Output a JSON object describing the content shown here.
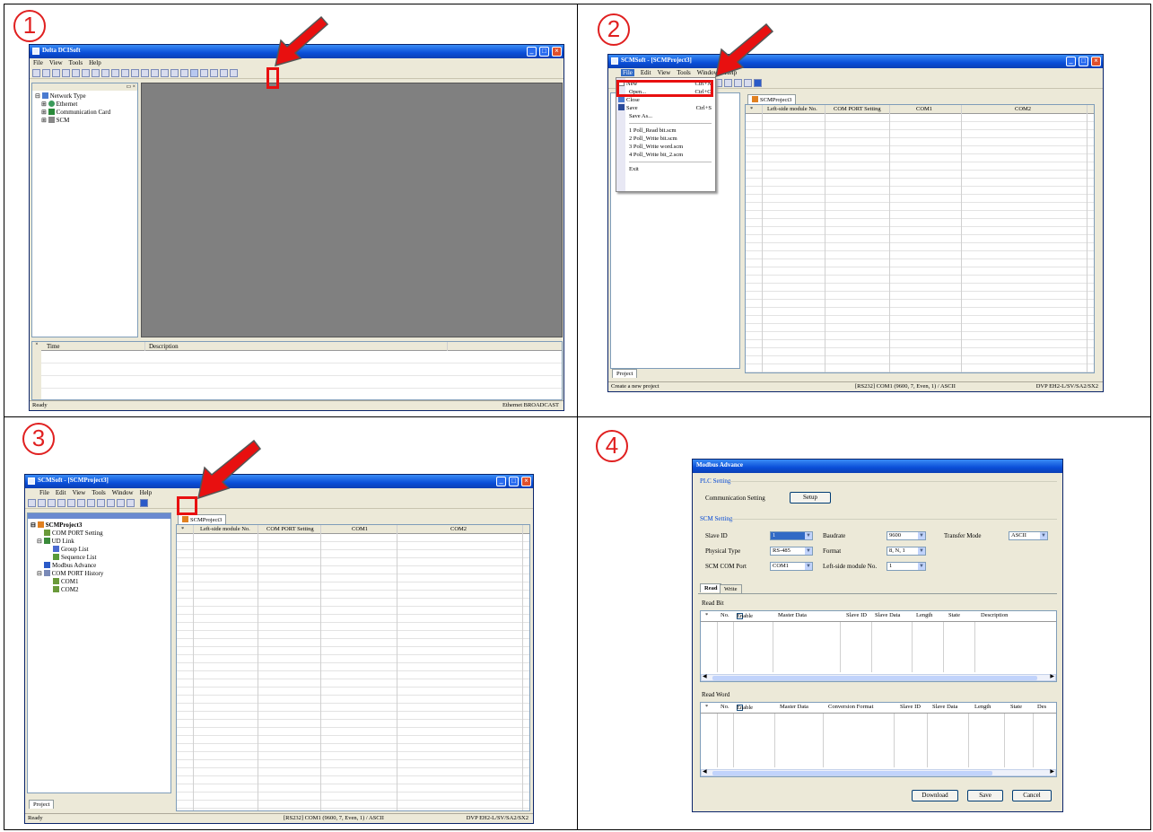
{
  "steps": [
    "1",
    "2",
    "3",
    "4"
  ],
  "p1": {
    "title": "Delta DCISoft",
    "menu": [
      "File",
      "View",
      "Tools",
      "Help"
    ],
    "tree": [
      "Network Type",
      "Ethernet",
      "Communication Card",
      "SCM"
    ],
    "log_cols": [
      "Time",
      "Description"
    ],
    "status_left": "Ready",
    "status_right": "Ethernet  BROADCAST"
  },
  "p2": {
    "title": "SCMSoft - [SCMProject3]",
    "menu": [
      "File",
      "Edit",
      "View",
      "Tools",
      "Window",
      "Help"
    ],
    "file_menu": [
      {
        "label": "New",
        "key": "Ctrl+N"
      },
      {
        "label": "Open...",
        "key": "Ctrl+O"
      },
      {
        "label": "Close",
        "key": ""
      },
      {
        "label": "Save",
        "key": "Ctrl+S"
      },
      {
        "label": "Save As...",
        "key": ""
      },
      {
        "label": "1 Poll_Read bit.scm",
        "key": ""
      },
      {
        "label": "2 Poll_Write bit.scm",
        "key": ""
      },
      {
        "label": "3 Poll_Write word.scm",
        "key": ""
      },
      {
        "label": "4 Poll_Write bit_2.scm",
        "key": ""
      },
      {
        "label": "Exit",
        "key": ""
      }
    ],
    "doc_tab": "SCMProject3",
    "cols": [
      "*",
      "Left-side module No.",
      "COM PORT Setting",
      "COM1",
      "COM2"
    ],
    "project_tab": "Project",
    "status_left": "Create a new project",
    "status_mid": "[RS232] COM1 (9600, 7, Even, 1) / ASCII",
    "status_right": "DVP EH2-L/SV/SA2/SX2"
  },
  "p3": {
    "title": "SCMSoft - [SCMProject3]",
    "menu": [
      "File",
      "Edit",
      "View",
      "Tools",
      "Window",
      "Help"
    ],
    "tree": [
      "SCMProject3",
      "COM PORT Setting",
      "UD Link",
      "Group List",
      "Sequence List",
      "Modbus Advance",
      "COM PORT History",
      "COM1",
      "COM2"
    ],
    "doc_tab": "SCMProject3",
    "cols": [
      "*",
      "Left-side module No.",
      "COM PORT Setting",
      "COM1",
      "COM2"
    ],
    "project_tab": "Project",
    "status_left": "Ready",
    "status_mid": "[RS232] COM1 (9600, 7, Even, 1) / ASCII",
    "status_right": "DVP EH2-L/SV/SA2/SX2"
  },
  "p4": {
    "title": "Modbus Advance",
    "plc_section": "PLC Setting",
    "comm_setting": "Communication Setting",
    "setup_btn": "Setup",
    "scm_section": "SCM Setting",
    "slave_id": "Slave ID",
    "slave_id_val": "1",
    "baudrate": "Baudrate",
    "baudrate_val": "9600",
    "transfer_mode": "Transfer Mode",
    "transfer_mode_val": "ASCII",
    "physical_type": "Physical Type",
    "physical_type_val": "RS-485",
    "format": "Format",
    "format_val": "8, N, 1",
    "scm_com_port": "SCM COM Port",
    "scm_com_port_val": "COM1",
    "left_module": "Left-side module No.",
    "left_module_val": "1",
    "tabs": [
      "Read",
      "Write"
    ],
    "read_bit": "Read Bit",
    "bit_cols": [
      "*",
      "No.",
      "Enable",
      "Master Data",
      "Slave ID",
      "Slave Data",
      "Length",
      "State",
      "Description"
    ],
    "read_word": "Read Word",
    "word_cols": [
      "*",
      "No.",
      "Enable",
      "Master Data",
      "Conversion Format",
      "Slave ID",
      "Slave Data",
      "Length",
      "State",
      "Des"
    ],
    "download_btn": "Download",
    "save_btn": "Save",
    "cancel_btn": "Cancel"
  },
  "colors": {
    "arrow": "#e81010",
    "titlebar": "#0a4ed8",
    "mdi_bg": "#808080"
  }
}
